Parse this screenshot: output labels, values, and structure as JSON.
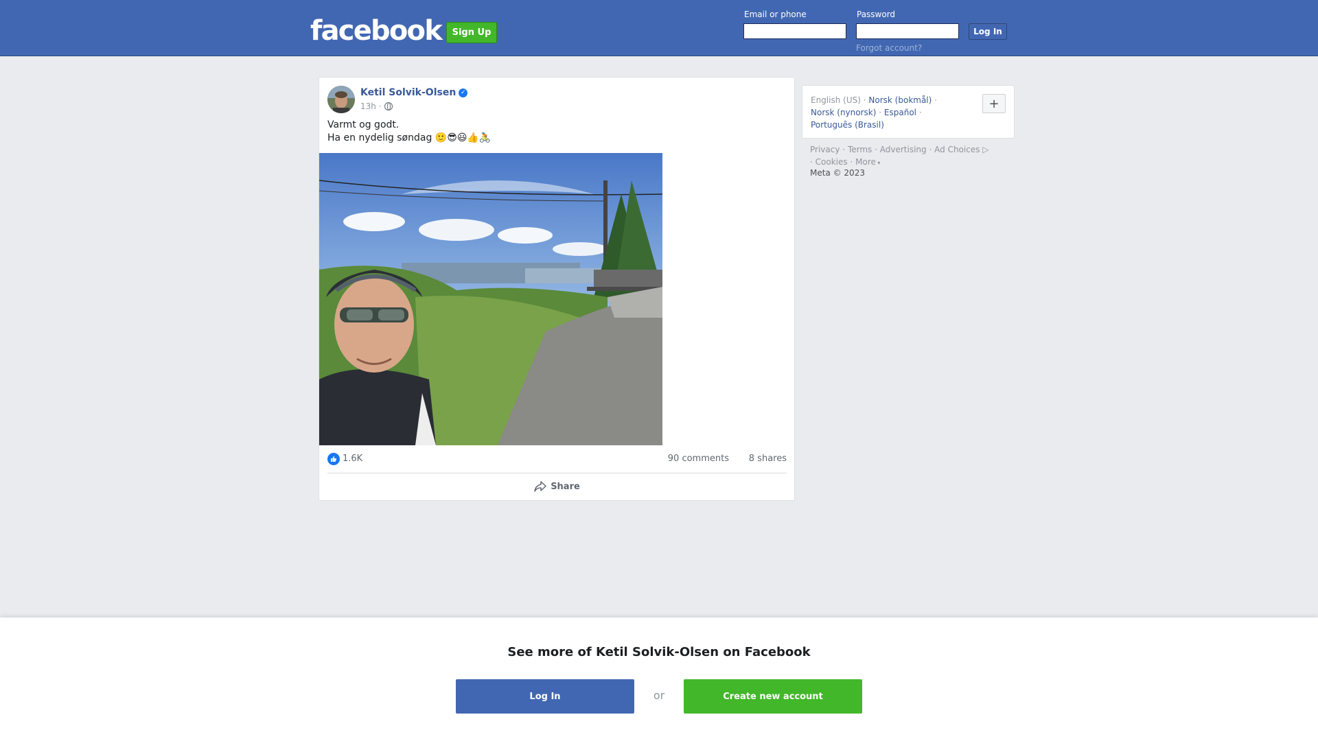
{
  "header": {
    "logo": "facebook",
    "signup_label": "Sign Up",
    "email_label": "Email or phone",
    "password_label": "Password",
    "login_label": "Log In",
    "forgot_label": "Forgot account?"
  },
  "post": {
    "author": "Ketil Solvik-Olsen",
    "verified_icon": "verified-badge-icon",
    "time": "13h",
    "privacy_separator": "·",
    "privacy_icon": "globe-icon",
    "text_line1": "Varmt og godt.",
    "text_line2": "Ha en nydelig søndag 🙂😎😃👍🚴",
    "reaction_icon": "like-icon",
    "likes": "1.6K",
    "comments": "90 comments",
    "shares": "8 shares",
    "share_label": "Share",
    "share_icon": "share-arrow-icon"
  },
  "languages": {
    "current": "English (US)",
    "norsk_bokmal": "Norsk (bokmål)",
    "norsk_nynorsk": "Norsk (nynorsk)",
    "espanol": "Español",
    "portugues": "Português (Brasil)",
    "sep": "·",
    "add_label": "+"
  },
  "footer": {
    "privacy": "Privacy",
    "terms": "Terms",
    "advertising": "Advertising",
    "ad_choices": "Ad Choices",
    "cookies": "Cookies",
    "more": "More",
    "sep": "·",
    "copyright": "Meta © 2023"
  },
  "banner": {
    "title": "See more of Ketil Solvik-Olsen on Facebook",
    "login_label": "Log In",
    "or_label": "or",
    "create_label": "Create new account"
  },
  "colors": {
    "brand_blue": "#4267b2",
    "link_blue": "#385898",
    "green": "#42b72a",
    "background": "#e9ebee"
  }
}
